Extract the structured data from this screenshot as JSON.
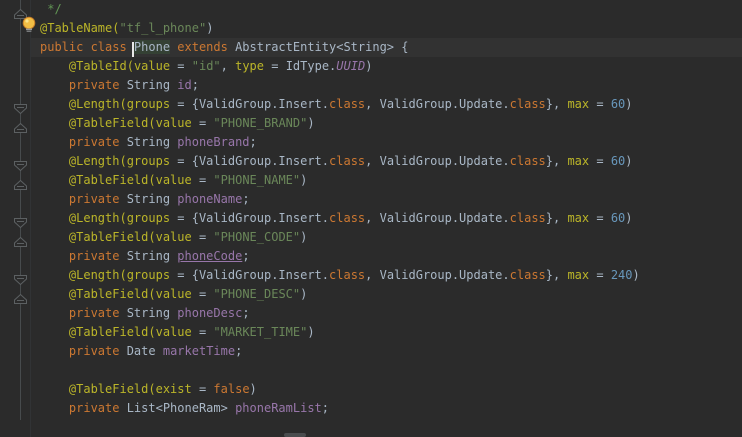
{
  "editor": {
    "background": "#2B2B2B",
    "caret_line_background": "#323232",
    "caret_line": 3,
    "bulb_line": 2,
    "colors": {
      "plain": "#A9B7C6",
      "keyword": "#CC7832",
      "annotation": "#BBB529",
      "string": "#6A8759",
      "number": "#6897BB",
      "field": "#9876AA",
      "constant": "#9876AA",
      "comment": "#629755"
    },
    "fold_markers": [
      {
        "line": 1,
        "type": "end"
      },
      {
        "line": 6,
        "type": "start"
      },
      {
        "line": 7,
        "type": "end"
      },
      {
        "line": 9,
        "type": "start"
      },
      {
        "line": 10,
        "type": "end"
      },
      {
        "line": 12,
        "type": "start"
      },
      {
        "line": 13,
        "type": "end"
      },
      {
        "line": 15,
        "type": "start"
      },
      {
        "line": 16,
        "type": "end"
      }
    ],
    "lines": [
      {
        "n": 1,
        "segments": [
          {
            "t": " */",
            "s": "comment"
          }
        ]
      },
      {
        "n": 2,
        "segments": [
          {
            "t": "@TableName(",
            "s": "annotation"
          },
          {
            "t": "\"tf_l_phone\"",
            "s": "string"
          },
          {
            "t": ")",
            "s": "plain"
          }
        ]
      },
      {
        "n": 3,
        "segments": [
          {
            "t": "public class ",
            "s": "keyword"
          },
          {
            "t": "Phone",
            "s": "plain",
            "hl": true,
            "caret": true
          },
          {
            "t": " ",
            "s": "plain"
          },
          {
            "t": "extends",
            "s": "keyword"
          },
          {
            "t": " AbstractEntity<String> {",
            "s": "plain"
          }
        ]
      },
      {
        "n": 4,
        "segments": [
          {
            "t": "    ",
            "s": "plain"
          },
          {
            "t": "@TableId(",
            "s": "annotation"
          },
          {
            "t": "value",
            "s": "annotation"
          },
          {
            "t": " = ",
            "s": "plain"
          },
          {
            "t": "\"id\"",
            "s": "string"
          },
          {
            "t": ", ",
            "s": "plain"
          },
          {
            "t": "type",
            "s": "annotation"
          },
          {
            "t": " = ",
            "s": "plain"
          },
          {
            "t": "IdType.",
            "s": "plain"
          },
          {
            "t": "UUID",
            "s": "constant"
          },
          {
            "t": ")",
            "s": "plain"
          }
        ]
      },
      {
        "n": 5,
        "segments": [
          {
            "t": "    ",
            "s": "plain"
          },
          {
            "t": "private",
            "s": "keyword"
          },
          {
            "t": " String ",
            "s": "plain"
          },
          {
            "t": "id",
            "s": "field"
          },
          {
            "t": ";",
            "s": "plain"
          }
        ]
      },
      {
        "n": 6,
        "segments": [
          {
            "t": "    ",
            "s": "plain"
          },
          {
            "t": "@Length(",
            "s": "annotation"
          },
          {
            "t": "groups",
            "s": "annotation"
          },
          {
            "t": " = {ValidGroup.Insert.",
            "s": "plain"
          },
          {
            "t": "class",
            "s": "keyword"
          },
          {
            "t": ", ValidGroup.Update.",
            "s": "plain"
          },
          {
            "t": "class",
            "s": "keyword"
          },
          {
            "t": "}, ",
            "s": "plain"
          },
          {
            "t": "max",
            "s": "annotation"
          },
          {
            "t": " = ",
            "s": "plain"
          },
          {
            "t": "60",
            "s": "number"
          },
          {
            "t": ")",
            "s": "plain"
          }
        ]
      },
      {
        "n": 7,
        "segments": [
          {
            "t": "    ",
            "s": "plain"
          },
          {
            "t": "@TableField(",
            "s": "annotation"
          },
          {
            "t": "value",
            "s": "annotation"
          },
          {
            "t": " = ",
            "s": "plain"
          },
          {
            "t": "\"PHONE_BRAND\"",
            "s": "string"
          },
          {
            "t": ")",
            "s": "plain"
          }
        ]
      },
      {
        "n": 8,
        "segments": [
          {
            "t": "    ",
            "s": "plain"
          },
          {
            "t": "private",
            "s": "keyword"
          },
          {
            "t": " String ",
            "s": "plain"
          },
          {
            "t": "phoneBrand",
            "s": "field"
          },
          {
            "t": ";",
            "s": "plain"
          }
        ]
      },
      {
        "n": 9,
        "segments": [
          {
            "t": "    ",
            "s": "plain"
          },
          {
            "t": "@Length(",
            "s": "annotation"
          },
          {
            "t": "groups",
            "s": "annotation"
          },
          {
            "t": " = {ValidGroup.Insert.",
            "s": "plain"
          },
          {
            "t": "class",
            "s": "keyword"
          },
          {
            "t": ", ValidGroup.Update.",
            "s": "plain"
          },
          {
            "t": "class",
            "s": "keyword"
          },
          {
            "t": "}, ",
            "s": "plain"
          },
          {
            "t": "max",
            "s": "annotation"
          },
          {
            "t": " = ",
            "s": "plain"
          },
          {
            "t": "60",
            "s": "number"
          },
          {
            "t": ")",
            "s": "plain"
          }
        ]
      },
      {
        "n": 10,
        "segments": [
          {
            "t": "    ",
            "s": "plain"
          },
          {
            "t": "@TableField(",
            "s": "annotation"
          },
          {
            "t": "value",
            "s": "annotation"
          },
          {
            "t": " = ",
            "s": "plain"
          },
          {
            "t": "\"PHONE_NAME\"",
            "s": "string"
          },
          {
            "t": ")",
            "s": "plain"
          }
        ]
      },
      {
        "n": 11,
        "segments": [
          {
            "t": "    ",
            "s": "plain"
          },
          {
            "t": "private",
            "s": "keyword"
          },
          {
            "t": " String ",
            "s": "plain"
          },
          {
            "t": "phoneName",
            "s": "field"
          },
          {
            "t": ";",
            "s": "plain"
          }
        ]
      },
      {
        "n": 12,
        "segments": [
          {
            "t": "    ",
            "s": "plain"
          },
          {
            "t": "@Length(",
            "s": "annotation"
          },
          {
            "t": "groups",
            "s": "annotation"
          },
          {
            "t": " = {ValidGroup.Insert.",
            "s": "plain"
          },
          {
            "t": "class",
            "s": "keyword"
          },
          {
            "t": ", ValidGroup.Update.",
            "s": "plain"
          },
          {
            "t": "class",
            "s": "keyword"
          },
          {
            "t": "}, ",
            "s": "plain"
          },
          {
            "t": "max",
            "s": "annotation"
          },
          {
            "t": " = ",
            "s": "plain"
          },
          {
            "t": "60",
            "s": "number"
          },
          {
            "t": ")",
            "s": "plain"
          }
        ]
      },
      {
        "n": 13,
        "segments": [
          {
            "t": "    ",
            "s": "plain"
          },
          {
            "t": "@TableField(",
            "s": "annotation"
          },
          {
            "t": "value",
            "s": "annotation"
          },
          {
            "t": " = ",
            "s": "plain"
          },
          {
            "t": "\"PHONE_CODE\"",
            "s": "string"
          },
          {
            "t": ")",
            "s": "plain"
          }
        ]
      },
      {
        "n": 14,
        "segments": [
          {
            "t": "    ",
            "s": "plain"
          },
          {
            "t": "private",
            "s": "keyword"
          },
          {
            "t": " String ",
            "s": "plain"
          },
          {
            "t": "phoneCode",
            "s": "field",
            "u": true
          },
          {
            "t": ";",
            "s": "plain"
          }
        ]
      },
      {
        "n": 15,
        "segments": [
          {
            "t": "    ",
            "s": "plain"
          },
          {
            "t": "@Length(",
            "s": "annotation"
          },
          {
            "t": "groups",
            "s": "annotation"
          },
          {
            "t": " = {ValidGroup.Insert.",
            "s": "plain"
          },
          {
            "t": "class",
            "s": "keyword"
          },
          {
            "t": ", ValidGroup.Update.",
            "s": "plain"
          },
          {
            "t": "class",
            "s": "keyword"
          },
          {
            "t": "}, ",
            "s": "plain"
          },
          {
            "t": "max",
            "s": "annotation"
          },
          {
            "t": " = ",
            "s": "plain"
          },
          {
            "t": "240",
            "s": "number"
          },
          {
            "t": ")",
            "s": "plain"
          }
        ]
      },
      {
        "n": 16,
        "segments": [
          {
            "t": "    ",
            "s": "plain"
          },
          {
            "t": "@TableField(",
            "s": "annotation"
          },
          {
            "t": "value",
            "s": "annotation"
          },
          {
            "t": " = ",
            "s": "plain"
          },
          {
            "t": "\"PHONE_DESC\"",
            "s": "string"
          },
          {
            "t": ")",
            "s": "plain"
          }
        ]
      },
      {
        "n": 17,
        "segments": [
          {
            "t": "    ",
            "s": "plain"
          },
          {
            "t": "private",
            "s": "keyword"
          },
          {
            "t": " String ",
            "s": "plain"
          },
          {
            "t": "phoneDesc",
            "s": "field"
          },
          {
            "t": ";",
            "s": "plain"
          }
        ]
      },
      {
        "n": 18,
        "segments": [
          {
            "t": "    ",
            "s": "plain"
          },
          {
            "t": "@TableField(",
            "s": "annotation"
          },
          {
            "t": "value",
            "s": "annotation"
          },
          {
            "t": " = ",
            "s": "plain"
          },
          {
            "t": "\"MARKET_TIME\"",
            "s": "string"
          },
          {
            "t": ")",
            "s": "plain"
          }
        ]
      },
      {
        "n": 19,
        "segments": [
          {
            "t": "    ",
            "s": "plain"
          },
          {
            "t": "private",
            "s": "keyword"
          },
          {
            "t": " Date ",
            "s": "plain"
          },
          {
            "t": "marketTime",
            "s": "field"
          },
          {
            "t": ";",
            "s": "plain"
          }
        ]
      },
      {
        "n": 20,
        "segments": []
      },
      {
        "n": 21,
        "segments": [
          {
            "t": "    ",
            "s": "plain"
          },
          {
            "t": "@TableField(",
            "s": "annotation"
          },
          {
            "t": "exist",
            "s": "annotation"
          },
          {
            "t": " = ",
            "s": "plain"
          },
          {
            "t": "false",
            "s": "keyword"
          },
          {
            "t": ")",
            "s": "plain"
          }
        ]
      },
      {
        "n": 22,
        "segments": [
          {
            "t": "    ",
            "s": "plain"
          },
          {
            "t": "private",
            "s": "keyword"
          },
          {
            "t": " List<PhoneRam> ",
            "s": "plain"
          },
          {
            "t": "phoneRamList",
            "s": "field"
          },
          {
            "t": ";",
            "s": "plain"
          }
        ]
      },
      {
        "n": 23,
        "segments": []
      }
    ],
    "icons": {
      "bulb": "intention-bulb-icon",
      "fold_start": "fold-collapse-icon",
      "fold_end": "fold-collapse-end-icon"
    }
  }
}
